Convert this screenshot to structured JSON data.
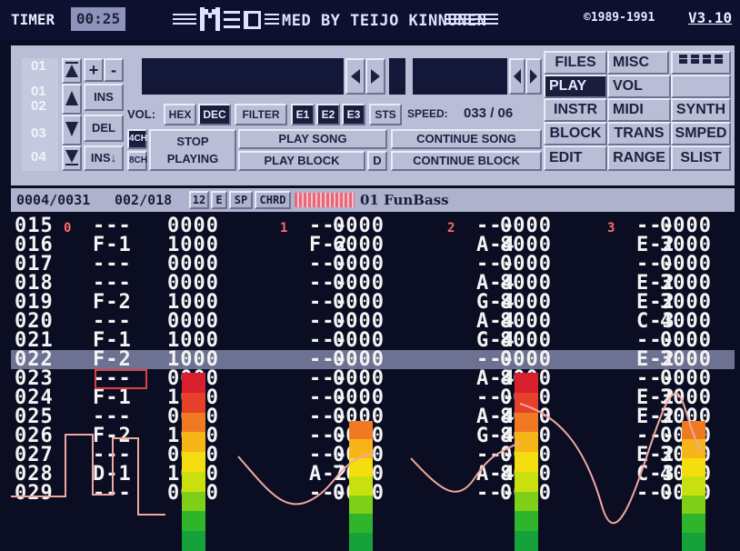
{
  "header": {
    "timer_label": "TIMER",
    "timer_value": "00:25",
    "title": "MED BY TEIJO KINNUNEN",
    "copyright": "©1989-1991",
    "version": "V3.10"
  },
  "controls": {
    "track_numbers": [
      "01",
      "01",
      "02",
      "03",
      "04"
    ],
    "plus": "+",
    "minus": "-",
    "ins": "INS",
    "del": "DEL",
    "ins_down": "INS↓",
    "ch4": "4CH",
    "ch8": "8CH",
    "stop_line1": "STOP",
    "stop_line2": "PLAYING",
    "vol_label": "VOL:",
    "hex": "HEX",
    "dec": "DEC",
    "filter": "FILTER",
    "e1": "E1",
    "e2": "E2",
    "e3": "E3",
    "sts": "STS",
    "speed_label": "SPEED:",
    "speed_value": "033 / 06",
    "play_song": "PLAY SONG",
    "play_block": "PLAY BLOCK",
    "d": "D",
    "continue_song": "CONTINUE SONG",
    "continue_block": "CONTINUE BLOCK"
  },
  "menu": {
    "files": "FILES",
    "misc": "MISC",
    "play": "PLAY",
    "vol": "VOL",
    "instr": "INSTR",
    "midi": "MIDI",
    "synth": "SYNTH",
    "block": "BLOCK",
    "trans": "TRANS",
    "smped": "SMPED",
    "edit": "EDIT",
    "range": "RANGE",
    "slist": "SLIST"
  },
  "info": {
    "position": "0004/0031",
    "block": "002/018",
    "octave": "12",
    "e": "E",
    "sp": "SP",
    "chrd": "CHRD",
    "instrument": "01 FunBass"
  },
  "pattern": {
    "track_labels": [
      "0",
      "1",
      "2",
      "3"
    ],
    "cursor_row_index": 7,
    "rows": [
      {
        "n": "015",
        "cells": [
          [
            "---",
            "0000"
          ],
          [
            "---",
            "0000"
          ],
          [
            "---",
            "0000"
          ],
          [
            "---",
            "0000"
          ]
        ]
      },
      {
        "n": "016",
        "cells": [
          [
            "F-1",
            "1000"
          ],
          [
            "F-2",
            "6000"
          ],
          [
            "A-4",
            "8000"
          ],
          [
            "E-2",
            "3000"
          ]
        ]
      },
      {
        "n": "017",
        "cells": [
          [
            "---",
            "0000"
          ],
          [
            "---",
            "0000"
          ],
          [
            "---",
            "0000"
          ],
          [
            "---",
            "0000"
          ]
        ]
      },
      {
        "n": "018",
        "cells": [
          [
            "---",
            "0000"
          ],
          [
            "---",
            "0000"
          ],
          [
            "A-4",
            "8000"
          ],
          [
            "E-2",
            "3000"
          ]
        ]
      },
      {
        "n": "019",
        "cells": [
          [
            "F-2",
            "1000"
          ],
          [
            "---",
            "0000"
          ],
          [
            "G-4",
            "8000"
          ],
          [
            "E-2",
            "3000"
          ]
        ]
      },
      {
        "n": "020",
        "cells": [
          [
            "---",
            "0000"
          ],
          [
            "---",
            "0000"
          ],
          [
            "A-4",
            "8000"
          ],
          [
            "C-3",
            "4000"
          ]
        ]
      },
      {
        "n": "021",
        "cells": [
          [
            "F-1",
            "1000"
          ],
          [
            "---",
            "0000"
          ],
          [
            "G-4",
            "8000"
          ],
          [
            "---",
            "0000"
          ]
        ]
      },
      {
        "n": "022",
        "cells": [
          [
            "F-2",
            "1000"
          ],
          [
            "---",
            "0000"
          ],
          [
            "---",
            "0000"
          ],
          [
            "E-2",
            "3000"
          ]
        ]
      },
      {
        "n": "023",
        "cells": [
          [
            "---",
            "0000"
          ],
          [
            "---",
            "0000"
          ],
          [
            "A-4",
            "8000"
          ],
          [
            "---",
            "0000"
          ]
        ]
      },
      {
        "n": "024",
        "cells": [
          [
            "F-1",
            "1000"
          ],
          [
            "---",
            "0000"
          ],
          [
            "---",
            "0000"
          ],
          [
            "E-2",
            "3000"
          ]
        ]
      },
      {
        "n": "025",
        "cells": [
          [
            "---",
            "0000"
          ],
          [
            "---",
            "0000"
          ],
          [
            "A-4",
            "8000"
          ],
          [
            "E-2",
            "3000"
          ]
        ]
      },
      {
        "n": "026",
        "cells": [
          [
            "F-2",
            "1000"
          ],
          [
            "---",
            "0000"
          ],
          [
            "G-4",
            "8000"
          ],
          [
            "---",
            "0000"
          ]
        ]
      },
      {
        "n": "027",
        "cells": [
          [
            "---",
            "0000"
          ],
          [
            "---",
            "0000"
          ],
          [
            "---",
            "0000"
          ],
          [
            "E-2",
            "3000"
          ]
        ]
      },
      {
        "n": "028",
        "cells": [
          [
            "D-1",
            "1000"
          ],
          [
            "A-2",
            "7000"
          ],
          [
            "A-4",
            "8000"
          ],
          [
            "C-3",
            "4000"
          ]
        ]
      },
      {
        "n": "029",
        "cells": [
          [
            "---",
            "0000"
          ],
          [
            "---",
            "0000"
          ],
          [
            "---",
            "0000"
          ],
          [
            "---",
            "0000"
          ]
        ]
      }
    ]
  },
  "vu_levels": [
    1.0,
    0.73,
    1.0,
    0.73
  ],
  "colors": {
    "panel": "#b9bdd5",
    "background": "#0b0d22",
    "accent_red": "#e04040",
    "scope": "#f0a8a0"
  }
}
